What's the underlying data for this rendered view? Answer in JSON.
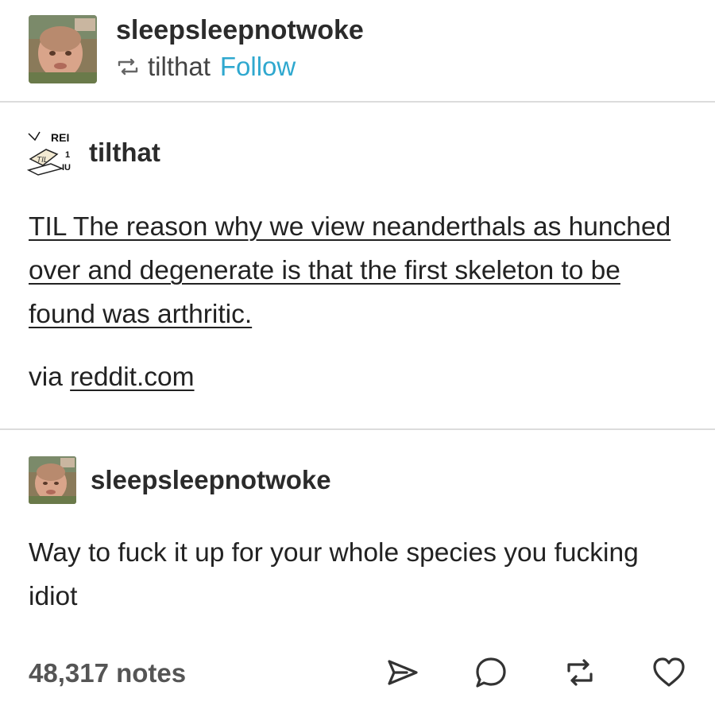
{
  "reblog_header": {
    "username": "sleepsleepnotwoke",
    "reblogged_from": "tilthat",
    "follow_label": "Follow",
    "icon": "reblog-icon",
    "avatar": "baby-photo-avatar"
  },
  "original_post": {
    "username": "tilthat",
    "avatar": "til-logo-avatar",
    "text": "TIL The reason why we view neanderthals as hunched over and degenerate is that the first skeleton to be found was arthritic.",
    "via_label": "via",
    "via_link": "reddit.com"
  },
  "reply": {
    "username": "sleepsleepnotwoke",
    "avatar": "baby-photo-avatar",
    "text": "Way to fuck it up for your whole species you fucking idiot"
  },
  "footer": {
    "notes": "48,317 notes",
    "actions": [
      "share-icon",
      "comment-icon",
      "reblog-icon",
      "like-heart-icon"
    ]
  },
  "colors": {
    "follow_link": "#2fa8cf",
    "text": "#222222",
    "notes": "#555555",
    "divider": "#dcdcdc"
  }
}
